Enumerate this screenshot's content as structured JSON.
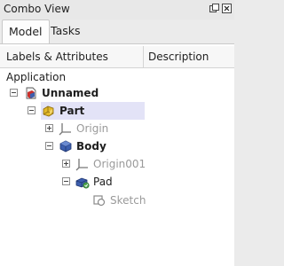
{
  "window": {
    "title": "Combo View"
  },
  "tabs": [
    {
      "label": "Model",
      "active": true
    },
    {
      "label": "Tasks",
      "active": false
    }
  ],
  "tree": {
    "columns": [
      "Labels & Attributes",
      "Description"
    ],
    "root_label": "Application",
    "items": [
      {
        "label": "Unnamed",
        "icon": "document-icon",
        "expander": "minus",
        "bold": true,
        "grey": false
      },
      {
        "label": "Part",
        "icon": "part-icon",
        "expander": "minus",
        "bold": true,
        "grey": false,
        "selected": true
      },
      {
        "label": "Origin",
        "icon": "origin-icon",
        "expander": "plus",
        "bold": false,
        "grey": true
      },
      {
        "label": "Body",
        "icon": "body-icon",
        "expander": "minus",
        "bold": true,
        "grey": false
      },
      {
        "label": "Origin001",
        "icon": "origin-icon",
        "expander": "plus",
        "bold": false,
        "grey": true
      },
      {
        "label": "Pad",
        "icon": "pad-icon",
        "expander": "minus",
        "bold": false,
        "grey": false
      },
      {
        "label": "Sketch",
        "icon": "sketch-icon",
        "expander": "none",
        "bold": false,
        "grey": true
      }
    ]
  },
  "colors": {
    "selection": "#e3e3f7",
    "part_yellow": "#e2b92b",
    "body_blue": "#3d5fae",
    "pad_green": "#4ea44e"
  }
}
